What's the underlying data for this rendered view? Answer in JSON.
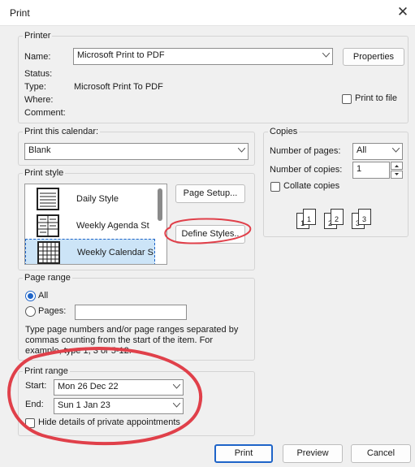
{
  "window": {
    "title": "Print",
    "close_glyph": "✕"
  },
  "printer": {
    "group_title": "Printer",
    "name_label": "Name:",
    "name_value": "Microsoft Print to PDF",
    "properties_label": "Properties",
    "status_label": "Status:",
    "status_value": "",
    "type_label": "Type:",
    "type_value": "Microsoft Print To PDF",
    "where_label": "Where:",
    "where_value": "",
    "comment_label": "Comment:",
    "comment_value": "",
    "print_to_file_label": "Print to file",
    "print_to_file_checked": false
  },
  "print_calendar": {
    "group_title": "Print this calendar:",
    "value": "Blank"
  },
  "print_style": {
    "group_title": "Print style",
    "items": [
      {
        "label": "Daily Style",
        "icon": "daily-style-icon",
        "selected": false
      },
      {
        "label": "Weekly Agenda St",
        "icon": "weekly-agenda-icon",
        "selected": false
      },
      {
        "label": "Weekly Calendar S",
        "icon": "weekly-calendar-icon",
        "selected": true
      }
    ],
    "page_setup_label": "Page Setup...",
    "define_styles_label": "Define Styles.."
  },
  "copies": {
    "group_title": "Copies",
    "num_pages_label": "Number of pages:",
    "num_pages_value": "All",
    "num_copies_label": "Number of copies:",
    "num_copies_value": "1",
    "collate_label": "Collate copies",
    "collate_checked": false,
    "collate_pages": [
      "1",
      "1",
      "2",
      "2",
      "3",
      "3"
    ]
  },
  "page_range": {
    "group_title": "Page range",
    "all_label": "All",
    "pages_label": "Pages:",
    "pages_value": "",
    "note_line1": "Type page numbers and/or page ranges separated by",
    "note_line2": "commas counting from the start of the item.  For",
    "note_line3": "example, type 1, 3 or 5-12."
  },
  "print_range": {
    "group_title": "Print range",
    "start_label": "Start:",
    "start_value": "Mon 26 Dec 22",
    "end_label": "End:",
    "end_value": "Sun 1 Jan 23",
    "hide_details_label": "Hide details of private appointments",
    "hide_details_checked": false
  },
  "footer": {
    "print_label": "Print",
    "preview_label": "Preview",
    "cancel_label": "Cancel"
  },
  "colors": {
    "accent": "#1e64c8",
    "annotation": "#e0404a",
    "selection": "#cce4f7"
  }
}
